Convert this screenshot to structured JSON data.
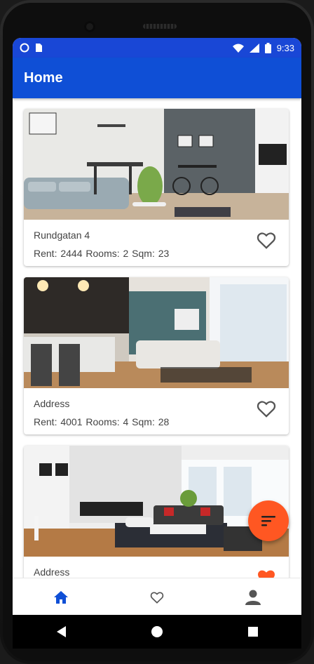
{
  "status": {
    "time": "9:33"
  },
  "appbar": {
    "title": "Home"
  },
  "listings": [
    {
      "address": "Rundgatan 4",
      "meta": "Rent: 2444  Rooms: 2  Sqm: 23",
      "favorite": false
    },
    {
      "address": "Address",
      "meta": "Rent: 4001  Rooms: 4  Sqm: 28",
      "favorite": false
    },
    {
      "address": "Address",
      "meta": "",
      "favorite": true
    }
  ],
  "colors": {
    "primary": "#0f4fd6",
    "status_bar": "#1947d6",
    "accent": "#ff5722",
    "text": "#444444"
  },
  "icons": {
    "status_left": [
      "record-icon",
      "sim-card-icon"
    ],
    "status_right": [
      "wifi-icon",
      "signal-icon",
      "battery-icon"
    ],
    "fab": "sort-icon",
    "bottom_nav": [
      "home-icon",
      "heart-outline-icon",
      "person-icon"
    ],
    "system_nav": [
      "back-icon",
      "home-circle-icon",
      "recents-icon"
    ]
  }
}
